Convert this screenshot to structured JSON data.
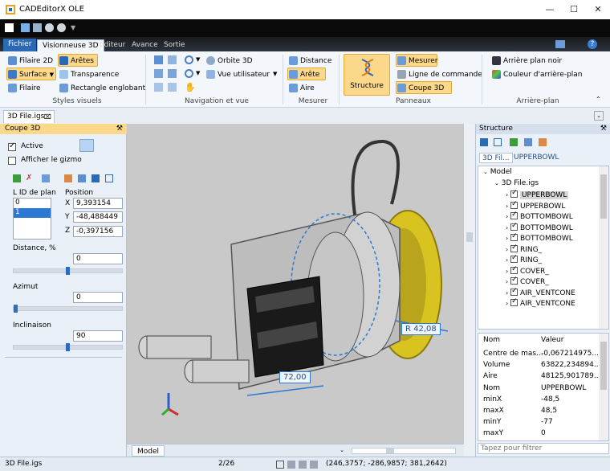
{
  "app": {
    "title": "CADEditorX OLE"
  },
  "menu_tabs": [
    {
      "label": "Fichier"
    },
    {
      "label": "Visionneuse 3D"
    },
    {
      "label": "Editeur"
    },
    {
      "label": "Avance"
    },
    {
      "label": "Sortie"
    }
  ],
  "ribbon": {
    "styles": {
      "filaire2d": "Filaire 2D",
      "aretes": "Arêtes",
      "surface": "Surface",
      "transparence": "Transparence",
      "filaire": "Filaire",
      "rectangle": "Rectangle englobant",
      "group": "Styles visuels"
    },
    "navigation": {
      "orbite": "Orbite 3D",
      "vue": "Vue utilisateur",
      "group": "Navigation et vue"
    },
    "mesurer": {
      "distance": "Distance",
      "arete": "Arête",
      "aire": "Aire",
      "group": "Mesurer"
    },
    "panneaux": {
      "structure": "Structure",
      "mesurer": "Mesurer",
      "ligne": "Ligne de commande",
      "coupe": "Coupe 3D",
      "group": "Panneaux"
    },
    "arriere": {
      "noir": "Arrière plan noir",
      "couleur": "Couleur d'arrière-plan",
      "group": "Arrière-plan"
    }
  },
  "doc_tab": {
    "label": "3D File.igs"
  },
  "left_panel": {
    "title": "Coupe 3D",
    "active_label": "Active",
    "gizmo_label": "Afficher le gizmo",
    "plane_id_header": "L ID de plan",
    "plane_ids": [
      "0",
      "1"
    ],
    "position_header": "Position",
    "x_label": "X",
    "x_value": "9,393154",
    "y_label": "Y",
    "y_value": "-48,488449",
    "z_label": "Z",
    "z_value": "-0,397156",
    "distance_label": "Distance, %",
    "distance_value": "0",
    "distance_level": 0.5,
    "azimut_label": "Azimut",
    "azimut_value": "0",
    "azimut_level": 0.0,
    "inclinaison_label": "Inclinaison",
    "inclinaison_value": "90",
    "inclinaison_level": 0.5
  },
  "viewport": {
    "dim_radius": "R 42,08",
    "dim_length": "72,00",
    "tab_label": "Model"
  },
  "right_panel": {
    "title": "Structure",
    "subtabs": [
      "3D Fil...",
      "UPPERBOWL"
    ],
    "tree_root": "Model",
    "tree_file": "3D File.igs",
    "tree_items": [
      "UPPERBOWL",
      "UPPERBOWL",
      "BOTTOMBOWL",
      "BOTTOMBOWL",
      "BOTTOMBOWL",
      "RING_",
      "RING_",
      "COVER_",
      "COVER_",
      "AIR_VENTCONE",
      "AIR_VENTCONE"
    ],
    "prop_header_name": "Nom",
    "prop_header_value": "Valeur",
    "props": [
      {
        "name": "Centre de mas...",
        "value": "-0,067214975..."
      },
      {
        "name": "Volume",
        "value": "63822,234894..."
      },
      {
        "name": "Aire",
        "value": "48125,901789..."
      },
      {
        "name": "Nom",
        "value": "UPPERBOWL"
      },
      {
        "name": "minX",
        "value": "-48,5"
      },
      {
        "name": "maxX",
        "value": "48,5"
      },
      {
        "name": "minY",
        "value": "-77"
      },
      {
        "name": "maxY",
        "value": "0"
      }
    ],
    "filter_placeholder": "Tapez pour filtrer"
  },
  "status": {
    "file": "3D File.igs",
    "page": "2/26",
    "coords": "(246,3757; -286,9857; 381,2642)"
  },
  "colors": {
    "accent": "#2b69b5",
    "highlight": "#fcd88a",
    "yellow_part": "#e8cf2a"
  }
}
